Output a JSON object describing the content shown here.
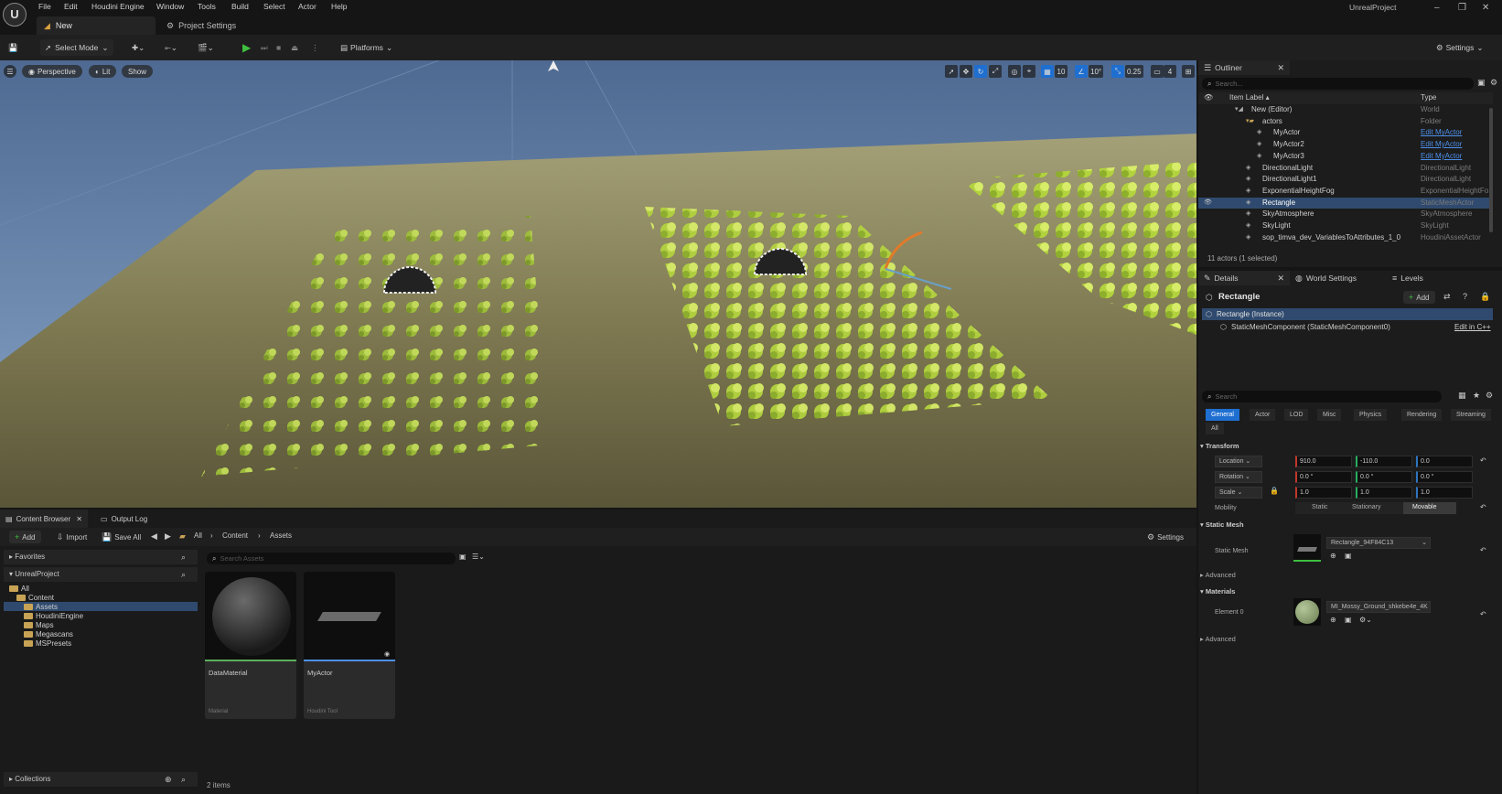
{
  "menubar": {
    "logo": "U",
    "items": [
      "File",
      "Edit",
      "Houdini Engine",
      "Window",
      "Tools",
      "Build",
      "Select",
      "Actor",
      "Help"
    ],
    "project_name": "UnrealProject",
    "window_controls": [
      "–",
      "❐",
      "✕"
    ]
  },
  "tabs": {
    "level_tab": "New",
    "project_settings_tab": "Project Settings"
  },
  "toolbar": {
    "select_mode": "Select Mode",
    "platforms": "Platforms",
    "settings": "Settings"
  },
  "viewport": {
    "perspective": "Perspective",
    "lit": "Lit",
    "show": "Show",
    "grid_snap": "10",
    "angle_snap": "10°",
    "scale_snap": "0.25",
    "camera_speed": "4"
  },
  "outliner": {
    "title": "Outliner",
    "search_placeholder": "Search...",
    "col_label": "Item Label ▴",
    "col_type": "Type",
    "rows": [
      {
        "label": "New (Editor)",
        "type": "World",
        "link": false,
        "indent": 0
      },
      {
        "label": "actors",
        "type": "Folder",
        "link": false,
        "indent": 1
      },
      {
        "label": "MyActor",
        "type": "Edit MyActor",
        "link": true,
        "indent": 2
      },
      {
        "label": "MyActor2",
        "type": "Edit MyActor",
        "link": true,
        "indent": 2
      },
      {
        "label": "MyActor3",
        "type": "Edit MyActor",
        "link": true,
        "indent": 2
      },
      {
        "label": "DirectionalLight",
        "type": "DirectionalLight",
        "link": false,
        "indent": 1
      },
      {
        "label": "DirectionalLight1",
        "type": "DirectionalLight",
        "link": false,
        "indent": 1
      },
      {
        "label": "ExponentialHeightFog",
        "type": "ExponentialHeightFo",
        "link": false,
        "indent": 1
      },
      {
        "label": "Rectangle",
        "type": "StaticMeshActor",
        "link": false,
        "indent": 1
      },
      {
        "label": "SkyAtmosphere",
        "type": "SkyAtmosphere",
        "link": false,
        "indent": 1
      },
      {
        "label": "SkyLight",
        "type": "SkyLight",
        "link": false,
        "indent": 1
      },
      {
        "label": "sop_timva_dev_VariablesToAttributes_1_0",
        "type": "HoudiniAssetActor",
        "link": false,
        "indent": 1
      }
    ],
    "footer": "11 actors (1 selected)"
  },
  "details": {
    "tab_details": "Details",
    "tab_world_settings": "World Settings",
    "tab_levels": "Levels",
    "actor_name": "Rectangle",
    "add_button": "Add",
    "instance_row": "Rectangle (Instance)",
    "component_row": "StaticMeshComponent (StaticMeshComponent0)",
    "edit_in_cpp": "Edit in C++",
    "search_placeholder": "Search",
    "categories": [
      "General",
      "Actor",
      "LOD",
      "Misc",
      "Physics",
      "Rendering",
      "Streaming",
      "All"
    ],
    "transform_header": "Transform",
    "location_label": "Location",
    "rotation_label": "Rotation",
    "scale_label": "Scale",
    "location": [
      "910.0",
      "-110.0",
      "0.0"
    ],
    "rotation": [
      "0.0 °",
      "0.0 °",
      "0.0 °"
    ],
    "scale": [
      "1.0",
      "1.0",
      "1.0"
    ],
    "mobility_label": "Mobility",
    "mobility_options": [
      "Static",
      "Stationary",
      "Movable"
    ],
    "static_mesh_header": "Static Mesh",
    "static_mesh_label": "Static Mesh",
    "static_mesh_value": "Rectangle_94F84C13",
    "advanced_1": "Advanced",
    "materials_header": "Materials",
    "element_label": "Element 0",
    "material_value": "MI_Mossy_Ground_shkebe4e_4K",
    "advanced_2": "Advanced"
  },
  "content_browser": {
    "tab_content_browser": "Content Browser",
    "tab_output_log": "Output Log",
    "add": "Add",
    "import": "Import",
    "save_all": "Save All",
    "breadcrumb": [
      "All",
      "Content",
      "Assets"
    ],
    "settings": "Settings",
    "favorites": "Favorites",
    "project": "UnrealProject",
    "tree": [
      {
        "label": "All",
        "level": 0
      },
      {
        "label": "Content",
        "level": 1
      },
      {
        "label": "Assets",
        "level": 2
      },
      {
        "label": "HoudiniEngine",
        "level": 2
      },
      {
        "label": "Maps",
        "level": 2
      },
      {
        "label": "Megascans",
        "level": 2
      },
      {
        "label": "MSPresets",
        "level": 2
      }
    ],
    "search_placeholder": "Search Assets",
    "assets": [
      {
        "name": "DataMaterial",
        "type": "Material"
      },
      {
        "name": "MyActor",
        "type": "Houdini Tool"
      }
    ],
    "collections": "Collections",
    "item_count": "2 items"
  },
  "colors": {
    "accent_blue": "#1f6fd1",
    "selection": "#2f4a6e",
    "play_green": "#3fbf3f",
    "folder_gold": "#c8a355",
    "link_blue": "#4d8fe8"
  }
}
